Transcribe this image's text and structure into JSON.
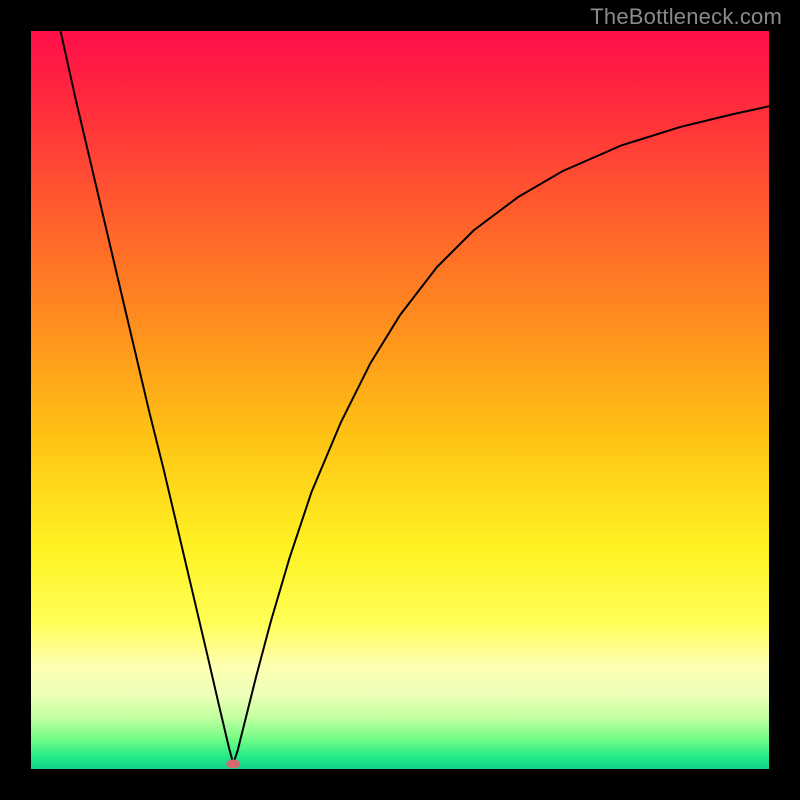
{
  "watermark": "TheBottleneck.com",
  "chart_data": {
    "type": "line",
    "title": "",
    "xlabel": "",
    "ylabel": "",
    "xlim": [
      0,
      100
    ],
    "ylim": [
      0,
      100
    ],
    "grid": false,
    "background_gradient": {
      "stops": [
        {
          "offset": 0.0,
          "color": "#ff0f4a"
        },
        {
          "offset": 0.1,
          "color": "#ff2b3c"
        },
        {
          "offset": 0.25,
          "color": "#ff5e2c"
        },
        {
          "offset": 0.4,
          "color": "#ff8f1e"
        },
        {
          "offset": 0.55,
          "color": "#ffc314"
        },
        {
          "offset": 0.7,
          "color": "#fff223"
        },
        {
          "offset": 0.8,
          "color": "#ffff55"
        },
        {
          "offset": 0.86,
          "color": "#ffffb0"
        },
        {
          "offset": 0.9,
          "color": "#ecffb8"
        },
        {
          "offset": 0.93,
          "color": "#c4ffa0"
        },
        {
          "offset": 0.96,
          "color": "#70fc86"
        },
        {
          "offset": 0.985,
          "color": "#21e988"
        },
        {
          "offset": 1.0,
          "color": "#0fd089"
        }
      ]
    },
    "minimum_marker": {
      "x": 27.4,
      "y": 0.7,
      "color": "#d46a6f"
    },
    "series": [
      {
        "name": "bottleneck-curve",
        "color": "#000000",
        "points": [
          {
            "x": 4.0,
            "y": 100.0
          },
          {
            "x": 6.0,
            "y": 91.0
          },
          {
            "x": 8.0,
            "y": 82.5
          },
          {
            "x": 10.0,
            "y": 74.0
          },
          {
            "x": 12.0,
            "y": 65.5
          },
          {
            "x": 14.0,
            "y": 57.0
          },
          {
            "x": 16.0,
            "y": 48.5
          },
          {
            "x": 18.0,
            "y": 40.5
          },
          {
            "x": 20.0,
            "y": 32.0
          },
          {
            "x": 22.0,
            "y": 23.5
          },
          {
            "x": 24.0,
            "y": 15.0
          },
          {
            "x": 25.5,
            "y": 8.5
          },
          {
            "x": 26.8,
            "y": 3.0
          },
          {
            "x": 27.4,
            "y": 0.7
          },
          {
            "x": 28.0,
            "y": 2.5
          },
          {
            "x": 29.0,
            "y": 6.5
          },
          {
            "x": 30.5,
            "y": 12.5
          },
          {
            "x": 32.5,
            "y": 20.0
          },
          {
            "x": 35.0,
            "y": 28.5
          },
          {
            "x": 38.0,
            "y": 37.5
          },
          {
            "x": 42.0,
            "y": 47.0
          },
          {
            "x": 46.0,
            "y": 55.0
          },
          {
            "x": 50.0,
            "y": 61.5
          },
          {
            "x": 55.0,
            "y": 68.0
          },
          {
            "x": 60.0,
            "y": 73.0
          },
          {
            "x": 66.0,
            "y": 77.5
          },
          {
            "x": 72.0,
            "y": 81.0
          },
          {
            "x": 80.0,
            "y": 84.5
          },
          {
            "x": 88.0,
            "y": 87.0
          },
          {
            "x": 95.0,
            "y": 88.7
          },
          {
            "x": 100.0,
            "y": 89.8
          }
        ]
      }
    ]
  }
}
